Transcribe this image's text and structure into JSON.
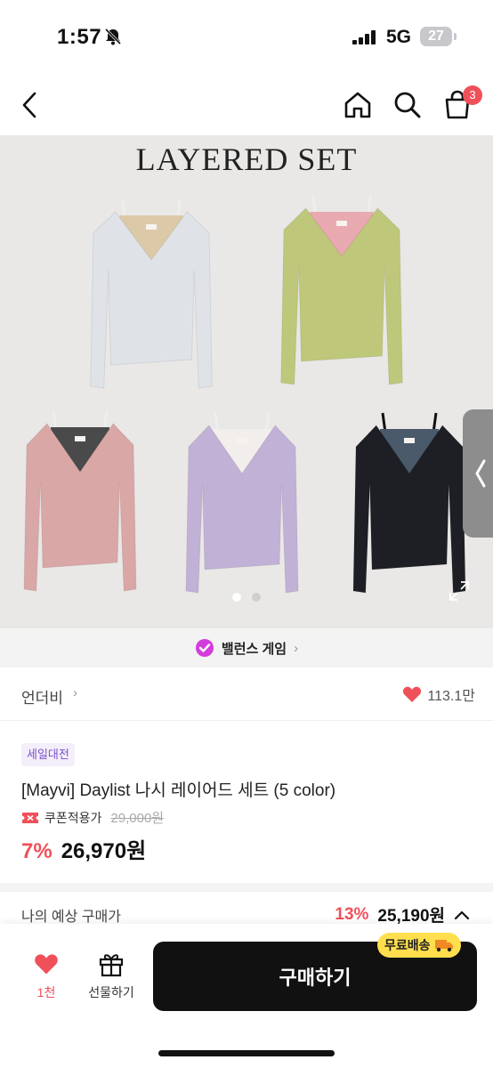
{
  "status_bar": {
    "time": "1:57",
    "network": "5G",
    "battery": "27"
  },
  "nav": {
    "cart_count": "3"
  },
  "hero": {
    "title": "LAYERED SET",
    "garment_colors": [
      "#dfe3e8",
      "#bfc77a",
      "#d9a7a6",
      "#c2b1d6",
      "#1d1f24"
    ],
    "inner_colors": [
      "#dcc9a8",
      "#e8a9b0",
      "#4a4a4a",
      "#f2eeec",
      "#4a5a6a"
    ],
    "slides": 2,
    "active_slide": 1
  },
  "balance_game": {
    "label": "밸런스 게임"
  },
  "brand": {
    "name": "언더비",
    "likes": "113.1만"
  },
  "product": {
    "tag": "세일대전",
    "title": "[Mayvi] Daylist 나시 레이어드 세트 (5 color)",
    "coupon_label": "쿠폰적용가",
    "original_price": "29,000원",
    "discount": "7%",
    "price": "26,970원"
  },
  "expected": {
    "label": "나의 예상 구매가",
    "discount": "13%",
    "price": "25,190원"
  },
  "bottom_bar": {
    "like_count": "1천",
    "gift_label": "선물하기",
    "buy_label": "구매하기",
    "shipping_badge": "무료배송"
  },
  "colors": {
    "accent": "#f0505a",
    "purple": "#7a52c7",
    "badge_yellow": "#ffdf4d"
  }
}
